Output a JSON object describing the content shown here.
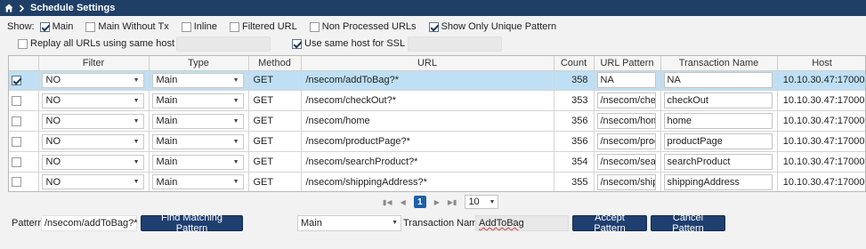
{
  "title": "Schedule Settings",
  "show": {
    "label": "Show:",
    "options": [
      {
        "label": "Main",
        "checked": true
      },
      {
        "label": "Main Without Tx",
        "checked": false
      },
      {
        "label": "Inline",
        "checked": false
      },
      {
        "label": "Filtered URL",
        "checked": false
      },
      {
        "label": "Non Processed URLs",
        "checked": false
      },
      {
        "label": "Show Only Unique Pattern",
        "checked": true
      }
    ]
  },
  "options2": {
    "replay_label": "Replay all URLs using same host",
    "replay_checked": false,
    "ssl_label": "Use same host for SSL",
    "ssl_checked": true
  },
  "table": {
    "columns": [
      "",
      "Filter",
      "Type",
      "Method",
      "URL",
      "Count",
      "URL Pattern",
      "Transaction Name",
      "Host"
    ],
    "rows": [
      {
        "selected": true,
        "filter": "NO",
        "type": "Main",
        "method": "GET",
        "url": "/nsecom/addToBag?*",
        "count": "358",
        "pattern": "NA",
        "tx": "NA",
        "host": "10.10.30.47:17000"
      },
      {
        "selected": false,
        "filter": "NO",
        "type": "Main",
        "method": "GET",
        "url": "/nsecom/checkOut?*",
        "count": "353",
        "pattern": "/nsecom/checkOut",
        "tx": "checkOut",
        "host": "10.10.30.47:17000"
      },
      {
        "selected": false,
        "filter": "NO",
        "type": "Main",
        "method": "GET",
        "url": "/nsecom/home",
        "count": "356",
        "pattern": "/nsecom/home",
        "tx": "home",
        "host": "10.10.30.47:17000"
      },
      {
        "selected": false,
        "filter": "NO",
        "type": "Main",
        "method": "GET",
        "url": "/nsecom/productPage?*",
        "count": "356",
        "pattern": "/nsecom/productPage",
        "tx": "productPage",
        "host": "10.10.30.47:17000"
      },
      {
        "selected": false,
        "filter": "NO",
        "type": "Main",
        "method": "GET",
        "url": "/nsecom/searchProduct?*",
        "count": "354",
        "pattern": "/nsecom/searchProduct",
        "tx": "searchProduct",
        "host": "10.10.30.47:17000"
      },
      {
        "selected": false,
        "filter": "NO",
        "type": "Main",
        "method": "GET",
        "url": "/nsecom/shippingAddress?*",
        "count": "355",
        "pattern": "/nsecom/shippingAddress",
        "tx": "shippingAddress",
        "host": "10.10.30.47:17000"
      }
    ]
  },
  "pager": {
    "current": "1",
    "page_size": "10"
  },
  "bottom": {
    "pattern_label": "Pattern:",
    "pattern_value": "/nsecom/addToBag?*",
    "find_button": "Find Matching Pattern",
    "type_value": "Main",
    "tx_label": "Transaction Name:",
    "tx_value": "AddToBag",
    "accept_button": "Accept Pattern",
    "cancel_button": "Cancel Pattern"
  },
  "colors": {
    "titlebar": "#1f3f66",
    "button": "#1f3f70",
    "selected_row": "#bfe0f4",
    "page_active": "#1f5fa8"
  }
}
